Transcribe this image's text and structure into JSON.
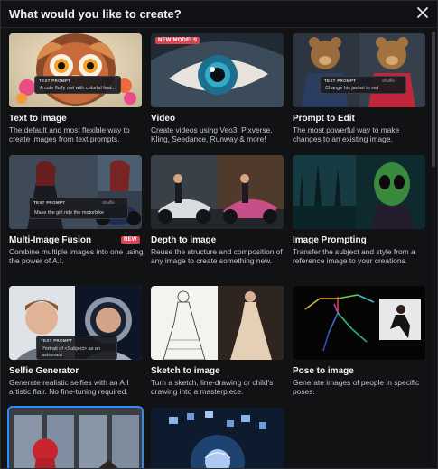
{
  "dialog": {
    "title": "What would you like to create?",
    "close_icon": "close-icon"
  },
  "overlays": {
    "text_prompt_label": "TEXT PROMPT",
    "shuffle_label": "Shuffle"
  },
  "cards": [
    {
      "title": "Text to image",
      "desc": "The default and most flexible way to create images from text prompts.",
      "prompt": "A cute fluffy owl with colorful feat..."
    },
    {
      "title": "Video",
      "desc": "Create videos using Veo3, Pixverse, Kling, Seedance, Runway & more!",
      "badge": "NEW MODELS"
    },
    {
      "title": "Prompt to Edit",
      "desc": "The most powerful way to make changes to an existing image.",
      "prompt": "Change his jacket to red"
    },
    {
      "title": "Multi-Image Fusion",
      "desc": "Combine multiple images into one using the power of A.I.",
      "badge": "NEW",
      "prompt": "Make the girl ride the motorbike"
    },
    {
      "title": "Depth to image",
      "desc": "Reuse the structure and composition of any image to create something new."
    },
    {
      "title": "Image Prompting",
      "desc": "Transfer the subject and style from a reference image to your creations."
    },
    {
      "title": "Selfie Generator",
      "desc": "Generate realistic selfies with an A.I artistic flair. No fine-tuning required.",
      "prompt": "Portrait of <Subject> as an astronaut"
    },
    {
      "title": "Sketch to image",
      "desc": "Turn a sketch, line-drawing or child's drawing into a masterpiece."
    },
    {
      "title": "Pose to image",
      "desc": "Generate images of people in specific poses."
    },
    {
      "title": "",
      "desc": ""
    },
    {
      "title": "",
      "desc": ""
    }
  ],
  "colors": {
    "background": "#111214",
    "badge": "#e0434f",
    "selected_outline": "#2f8cff"
  }
}
